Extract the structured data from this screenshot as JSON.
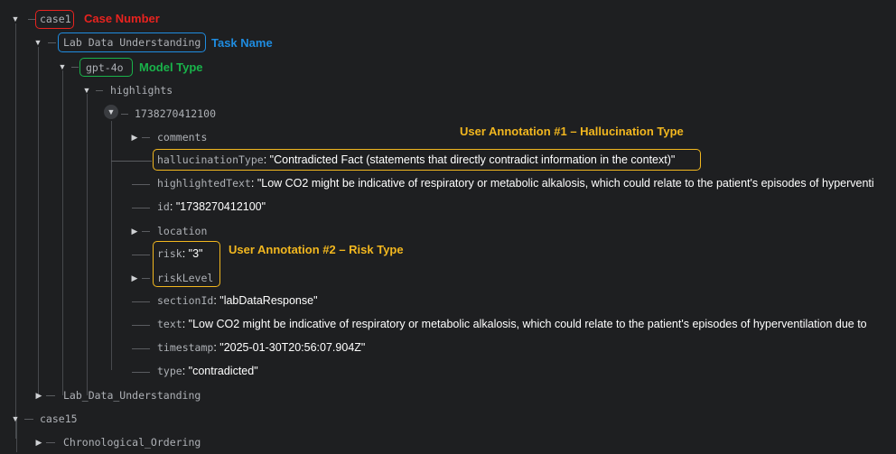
{
  "colors": {
    "case_number": "#e8231f",
    "task_name": "#1f8ce0",
    "model_type": "#19b34a",
    "user_annotation": "#f2b71f"
  },
  "icons": {
    "expanded": "caret-down-icon",
    "collapsed": "caret-right-icon"
  },
  "tree": {
    "case1": "case1",
    "task": "Lab Data Understanding",
    "model": "gpt-4o",
    "highlights": "highlights",
    "highlight_id": "1738270412100",
    "comments": "comments",
    "hallucination_key": "hallucinationType",
    "hallucination_value": "\"Contradicted Fact (statements that directly contradict information in the context)\"",
    "highlighted_key": "highlightedText",
    "highlighted_value": "\"Low CO2 might be indicative of respiratory or metabolic alkalosis, which could relate to the patient's episodes of hyperventi",
    "id_key": "id",
    "id_value": "\"1738270412100\"",
    "location": "location",
    "risk_key": "risk",
    "risk_value": "\"3\"",
    "risk_level": "riskLevel",
    "section_key": "sectionId",
    "section_value": "\"labDataResponse\"",
    "text_key": "text",
    "text_value": "\"Low CO2 might be indicative of respiratory or metabolic alkalosis, which could relate to the patient's episodes of hyperventilation due to",
    "timestamp_key": "timestamp",
    "timestamp_value": "\"2025-01-30T20:56:07.904Z\"",
    "type_key": "type",
    "type_value": "\"contradicted\"",
    "lab_data": "Lab_Data_Understanding",
    "case15": "case15",
    "chrono": "Chronological_Ordering"
  },
  "labels": {
    "case_number": "Case Number",
    "task_name": "Task Name",
    "model_type": "Model Type",
    "annotation1": "User Annotation #1 – Hallucination Type",
    "annotation2": "User Annotation #2 – Risk Type"
  }
}
